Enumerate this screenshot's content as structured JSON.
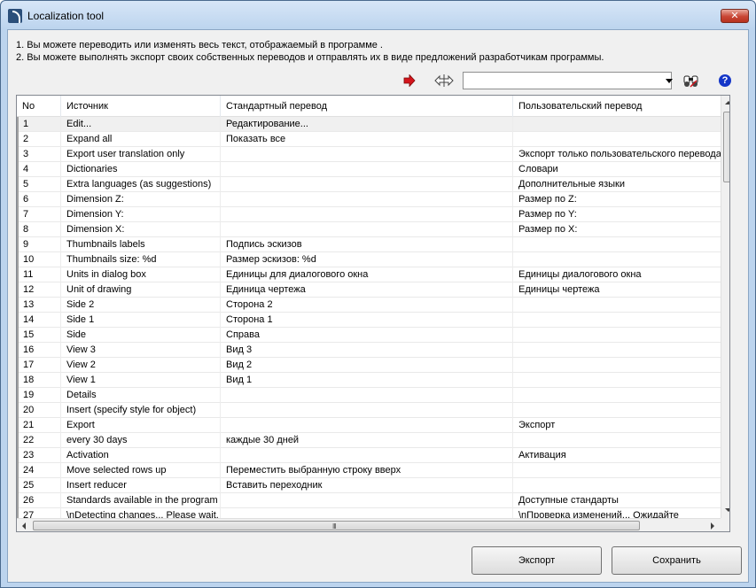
{
  "window": {
    "title": "Localization tool",
    "close_glyph": "✕"
  },
  "instructions": {
    "line1": "1. Вы можете переводить или изменять весь текст, отображаемый в программе .",
    "line2": "2. Вы можете выполнять экспорт своих собственных переводов и отправлять их в виде предложений разработчикам программы."
  },
  "toolbar": {
    "icons": [
      "arrow-right-icon",
      "swap-arrows-icon",
      "find-icon",
      "help-icon"
    ],
    "combo_value": "",
    "help_glyph": "?"
  },
  "table": {
    "columns": [
      "No",
      "Источник",
      "Стандартный перевод",
      "Пользовательский перевод"
    ],
    "rows": [
      [
        "1",
        "Edit...",
        "Редактирование...",
        ""
      ],
      [
        "2",
        "Expand all",
        "Показать все",
        ""
      ],
      [
        "3",
        "Export user translation only",
        "",
        "Экспорт только пользовательского перевода"
      ],
      [
        "4",
        "Dictionaries",
        "",
        "Словари"
      ],
      [
        "5",
        "Extra languages (as suggestions)",
        "",
        "Дополнительные языки"
      ],
      [
        "6",
        "Dimension Z:",
        "",
        "Размер по Z:"
      ],
      [
        "7",
        "Dimension Y:",
        "",
        "Размер по Y:"
      ],
      [
        "8",
        "Dimension X:",
        "",
        "Размер по X:"
      ],
      [
        "9",
        "Thumbnails labels",
        "Подпись эскизов",
        ""
      ],
      [
        "10",
        "Thumbnails size: %d",
        "Размер эскизов: %d",
        ""
      ],
      [
        "11",
        "Units in dialog box",
        "Единицы для диалогового окна",
        "Единицы диалогового окна"
      ],
      [
        "12",
        "Unit of drawing",
        "Единица чертежа",
        "Единицы чертежа"
      ],
      [
        "13",
        "Side 2",
        "Сторона 2",
        ""
      ],
      [
        "14",
        "Side 1",
        "Сторона 1",
        ""
      ],
      [
        "15",
        "Side",
        "Справа",
        ""
      ],
      [
        "16",
        "View 3",
        "Вид 3",
        ""
      ],
      [
        "17",
        "View 2",
        "Вид 2",
        ""
      ],
      [
        "18",
        "View 1",
        "Вид 1",
        ""
      ],
      [
        "19",
        "Details",
        "",
        ""
      ],
      [
        "20",
        "Insert (specify style for object)",
        "",
        ""
      ],
      [
        "21",
        "Export",
        "",
        "Экспорт"
      ],
      [
        "22",
        "every 30 days",
        "каждые 30 дней",
        ""
      ],
      [
        "23",
        "Activation",
        "",
        "Активация"
      ],
      [
        "24",
        "Move selected rows up",
        "Переместить выбранную строку вверх",
        ""
      ],
      [
        "25",
        "Insert reducer",
        "Вставить переходник",
        ""
      ],
      [
        "26",
        "Standards available in the program",
        "",
        "Доступные стандарты"
      ],
      [
        "27",
        "\\nDetecting changes... Please wait.",
        "",
        "\\nПроверка изменений... Ожидайте"
      ]
    ],
    "selected_row": 0,
    "hscroll_grip": "III"
  },
  "buttons": {
    "export": "Экспорт",
    "save": "Сохранить"
  },
  "colors": {
    "accent_red": "#d4141c",
    "help_blue": "#1436c8",
    "title_bg": "#bcd4ee"
  }
}
